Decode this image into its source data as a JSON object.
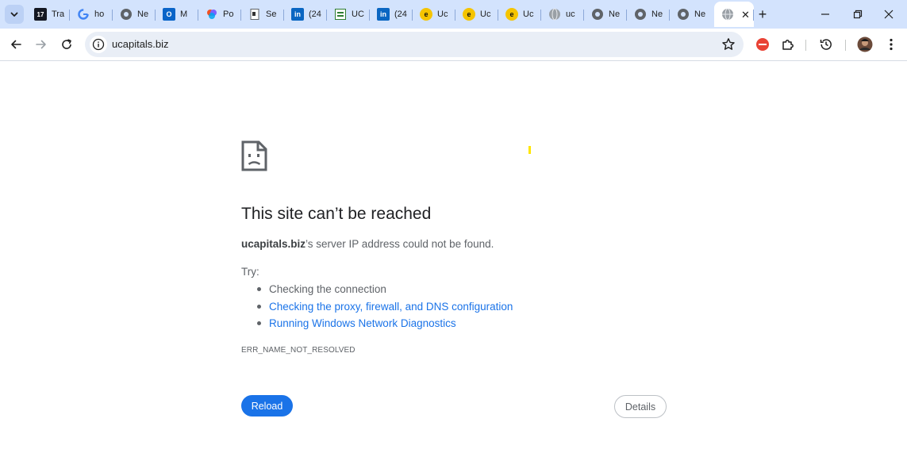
{
  "tabs": [
    {
      "title": "Tra",
      "icon": "tradingview-icon",
      "bg": "#131722",
      "glyph": "17"
    },
    {
      "title": "ho",
      "icon": "google-icon",
      "bg": "#ffffff",
      "glyph": "G"
    },
    {
      "title": "Ne",
      "icon": "chrome-page-icon",
      "bg": "#5f6368",
      "glyph": ""
    },
    {
      "title": "M",
      "icon": "outlook-icon",
      "bg": "#0a64c8",
      "glyph": "O"
    },
    {
      "title": "Po",
      "icon": "copilot-icon",
      "bg": "#7b61ff",
      "glyph": ""
    },
    {
      "title": "Se",
      "icon": "document-icon",
      "bg": "#ffffff",
      "glyph": ""
    },
    {
      "title": "(24",
      "icon": "linkedin-icon",
      "bg": "#0a66c2",
      "glyph": "in"
    },
    {
      "title": "UC",
      "icon": "sheet-icon",
      "bg": "#2e7d32",
      "glyph": ""
    },
    {
      "title": "(24",
      "icon": "linkedin-icon",
      "bg": "#0a66c2",
      "glyph": "in"
    },
    {
      "title": "Uc",
      "icon": "yellow-logo-icon",
      "bg": "#f5c400",
      "glyph": "e"
    },
    {
      "title": "Uc",
      "icon": "yellow-logo-icon",
      "bg": "#f5c400",
      "glyph": "e"
    },
    {
      "title": "Uc",
      "icon": "yellow-logo-icon",
      "bg": "#f5c400",
      "glyph": "e"
    },
    {
      "title": "uc",
      "icon": "globe-icon",
      "bg": "#9aa0a6",
      "glyph": ""
    },
    {
      "title": "Ne",
      "icon": "chrome-page-icon",
      "bg": "#5f6368",
      "glyph": ""
    },
    {
      "title": "Ne",
      "icon": "chrome-page-icon",
      "bg": "#5f6368",
      "glyph": ""
    },
    {
      "title": "Ne",
      "icon": "chrome-page-icon",
      "bg": "#5f6368",
      "glyph": ""
    }
  ],
  "active_tab": {
    "icon": "globe-icon",
    "close_symbol": "✕"
  },
  "new_tab_symbol": "+",
  "omnibox": {
    "url": "ucapitals.biz"
  },
  "error": {
    "title": "This site can’t be reached",
    "summary_host": "ucapitals.biz",
    "summary_rest": "’s server IP address could not be found.",
    "try_label": "Try:",
    "suggestions": [
      {
        "text": "Checking the connection",
        "is_link": false
      },
      {
        "text": "Checking the proxy, firewall, and DNS configuration",
        "is_link": true
      },
      {
        "text": "Running Windows Network Diagnostics",
        "is_link": true
      }
    ],
    "code": "ERR_NAME_NOT_RESOLVED",
    "reload_label": "Reload",
    "details_label": "Details"
  },
  "colors": {
    "accent": "#1a73e8",
    "tabstrip": "#d3e3fd",
    "omnibox": "#e9eef6"
  }
}
